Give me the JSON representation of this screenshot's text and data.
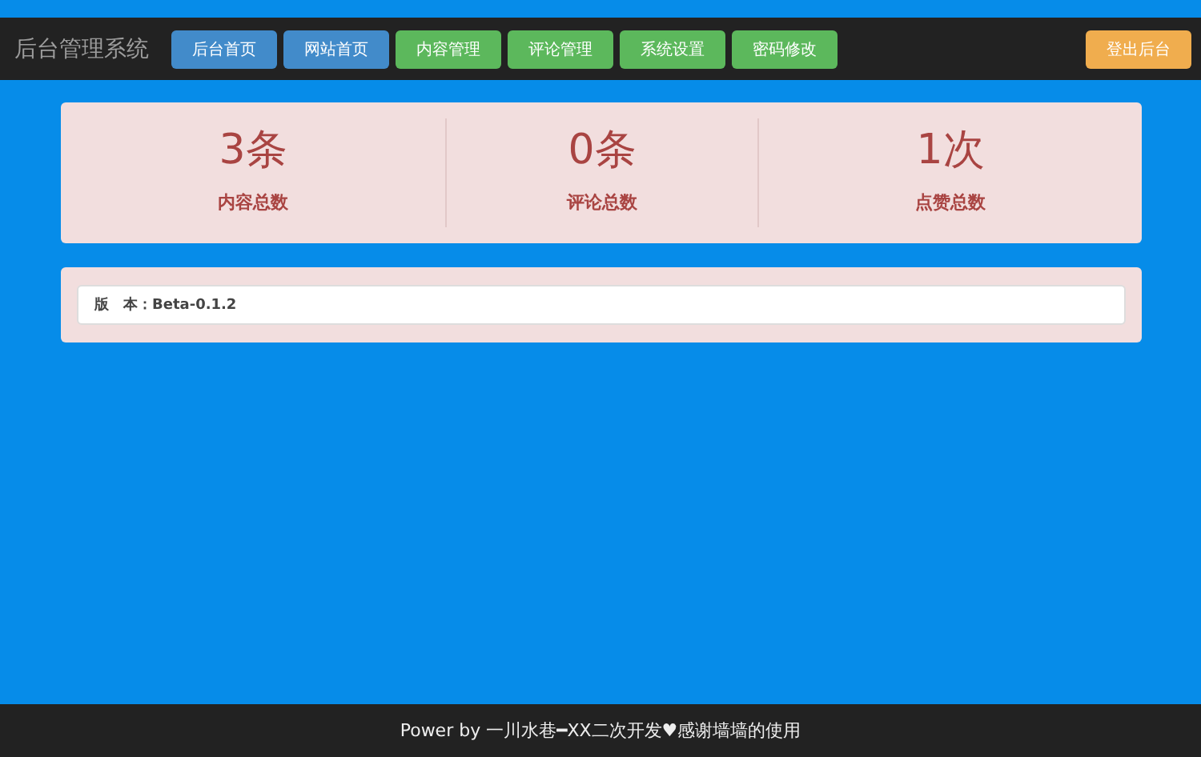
{
  "navbar": {
    "brand": "后台管理系统",
    "buttons": [
      {
        "label": "后台首页",
        "kind": "primary"
      },
      {
        "label": "网站首页",
        "kind": "primary"
      },
      {
        "label": "内容管理",
        "kind": "success"
      },
      {
        "label": "评论管理",
        "kind": "success"
      },
      {
        "label": "系统设置",
        "kind": "success"
      },
      {
        "label": "密码修改",
        "kind": "success"
      }
    ],
    "logout_button": {
      "label": "登出后台",
      "kind": "warning"
    }
  },
  "stats": [
    {
      "value": "3条",
      "label": "内容总数"
    },
    {
      "value": "0条",
      "label": "评论总数"
    },
    {
      "value": "1次",
      "label": "点赞总数"
    }
  ],
  "version": "版　本：Beta-0.1.2",
  "footer": "Power by 一川水巷━XX二次开发♥感谢墙墙的使用"
}
